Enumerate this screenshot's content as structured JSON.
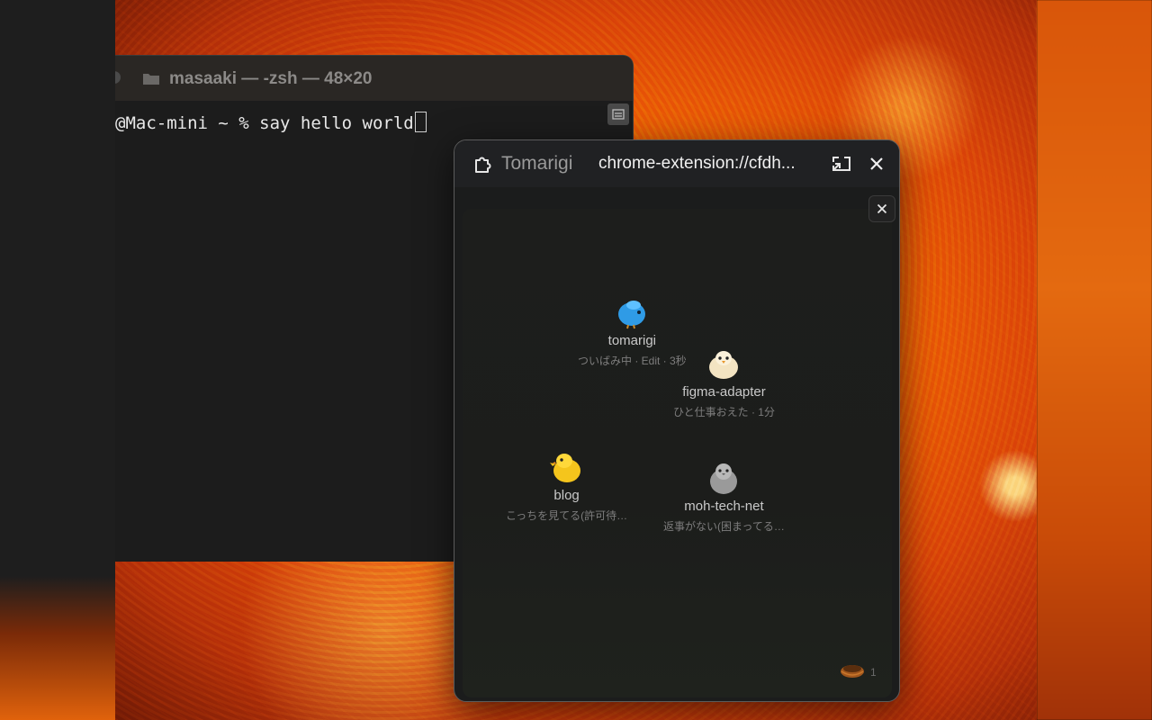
{
  "terminal": {
    "title": "masaaki — -zsh — 48×20",
    "prompt_line": "@Mac-mini ~ % say hello world"
  },
  "popup": {
    "extension_name": "Tomarigi",
    "url": "chrome-extension://cfdh...",
    "perch_count": "1"
  },
  "birds": [
    {
      "name": "tomarigi",
      "status": "ついばみ中 · Edit · 3秒",
      "icon": "blue-bird-icon",
      "color": "#2f9be6"
    },
    {
      "name": "figma-adapter",
      "status": "ひと仕事おえた · 1分",
      "icon": "cream-chick-icon",
      "color": "#f3e4c2"
    },
    {
      "name": "blog",
      "status": "こっちを見てる(許可待…",
      "icon": "yellow-chick-icon",
      "color": "#f5c51c"
    },
    {
      "name": "moh-tech-net",
      "status": "返事がない(困まってる…",
      "icon": "gray-bird-icon",
      "color": "#9a9a9a"
    }
  ],
  "colors": {
    "terminal_bg": "#1c1c1c",
    "popup_bg": "#1b1c1c",
    "wallpaper_accent": "#f26a05"
  }
}
